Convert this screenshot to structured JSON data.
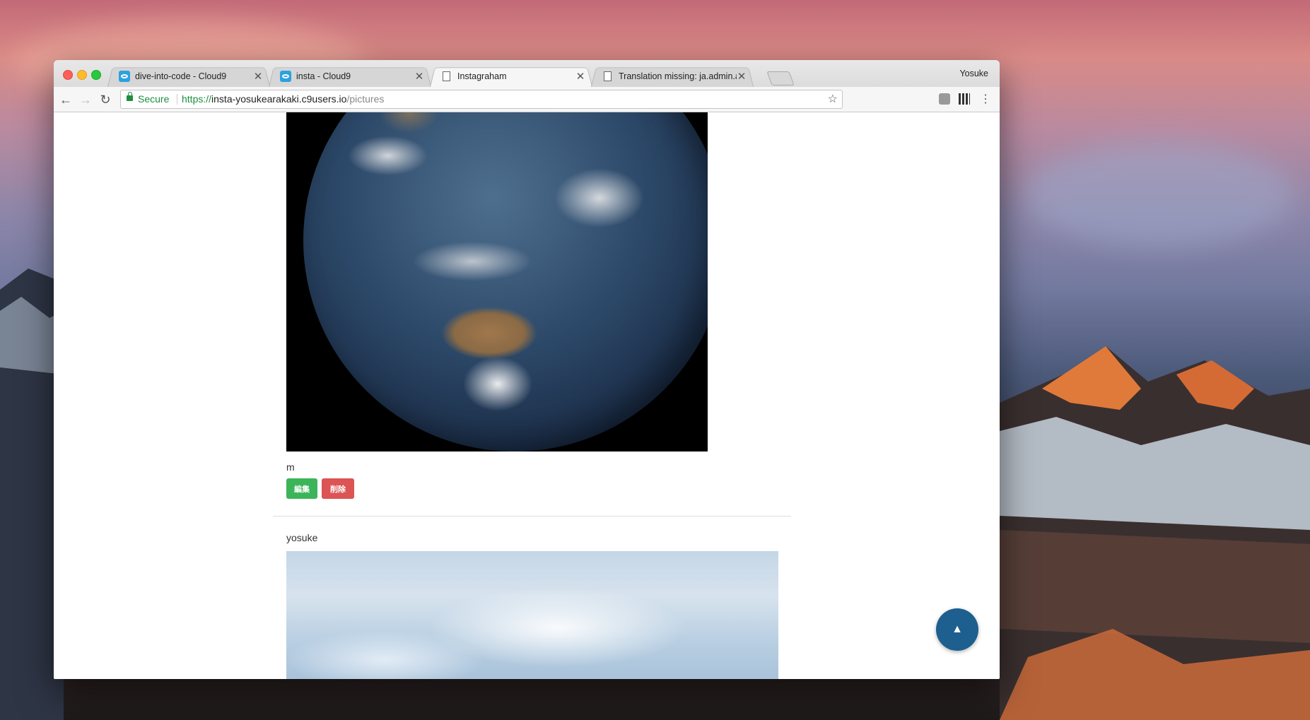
{
  "browser": {
    "profile_name": "Yosuke",
    "tabs": [
      {
        "title": "dive-into-code - Cloud9",
        "icon": "cloud9-icon",
        "active": false
      },
      {
        "title": "insta - Cloud9",
        "icon": "cloud9-icon",
        "active": false
      },
      {
        "title": "Instagraham",
        "icon": "document-icon",
        "active": true
      },
      {
        "title": "Translation missing: ja.admin.a",
        "icon": "document-icon",
        "active": false
      }
    ],
    "address": {
      "security_label": "Secure",
      "scheme": "https://",
      "host": "insta-yosukearakaki.c9users.io",
      "path": "/pictures"
    }
  },
  "page": {
    "post1": {
      "image_alt": "Earth from space",
      "caption": "m",
      "edit_label": "編集",
      "delete_label": "削除"
    },
    "post2": {
      "username": "yosuke",
      "image_alt": "Sky with clouds"
    },
    "scroll_top_symbol": "▲"
  },
  "colors": {
    "edit_button": "#3cb55a",
    "delete_button": "#dc5454",
    "scroll_top_button": "#1d5f8f",
    "secure_green": "#1e8e3e"
  }
}
